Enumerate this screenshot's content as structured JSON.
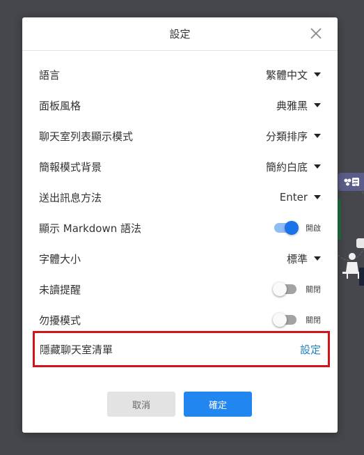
{
  "dialog": {
    "title": "設定",
    "settings": [
      {
        "kind": "select",
        "label": "語言",
        "value": "繁體中文"
      },
      {
        "kind": "select",
        "label": "面板風格",
        "value": "典雅黑"
      },
      {
        "kind": "select",
        "label": "聊天室列表顯示模式",
        "value": "分類排序"
      },
      {
        "kind": "select",
        "label": "簡報模式背景",
        "value": "簡約白底"
      },
      {
        "kind": "select",
        "label": "送出訊息方法",
        "value": "Enter"
      },
      {
        "kind": "toggle",
        "label": "顯示 Markdown 語法",
        "on": true,
        "state_text": "開啟"
      },
      {
        "kind": "select",
        "label": "字體大小",
        "value": "標準"
      },
      {
        "kind": "toggle",
        "label": "未讀提醒",
        "on": false,
        "state_text": "關閉"
      },
      {
        "kind": "toggle",
        "label": "勿擾模式",
        "on": false,
        "state_text": "關閉"
      }
    ],
    "hidden_chatrooms": {
      "label": "隱藏聊天室清單",
      "action": "設定"
    },
    "buttons": {
      "cancel": "取消",
      "confirm": "確定"
    }
  },
  "colors": {
    "backdrop": "#45474c",
    "accent": "#1a73e8",
    "primary_button": "#2286f1",
    "link": "#1f7fbf",
    "highlight_border": "#d51218"
  },
  "icons": {
    "close": "close-icon",
    "dropdown": "caret-down-icon"
  }
}
